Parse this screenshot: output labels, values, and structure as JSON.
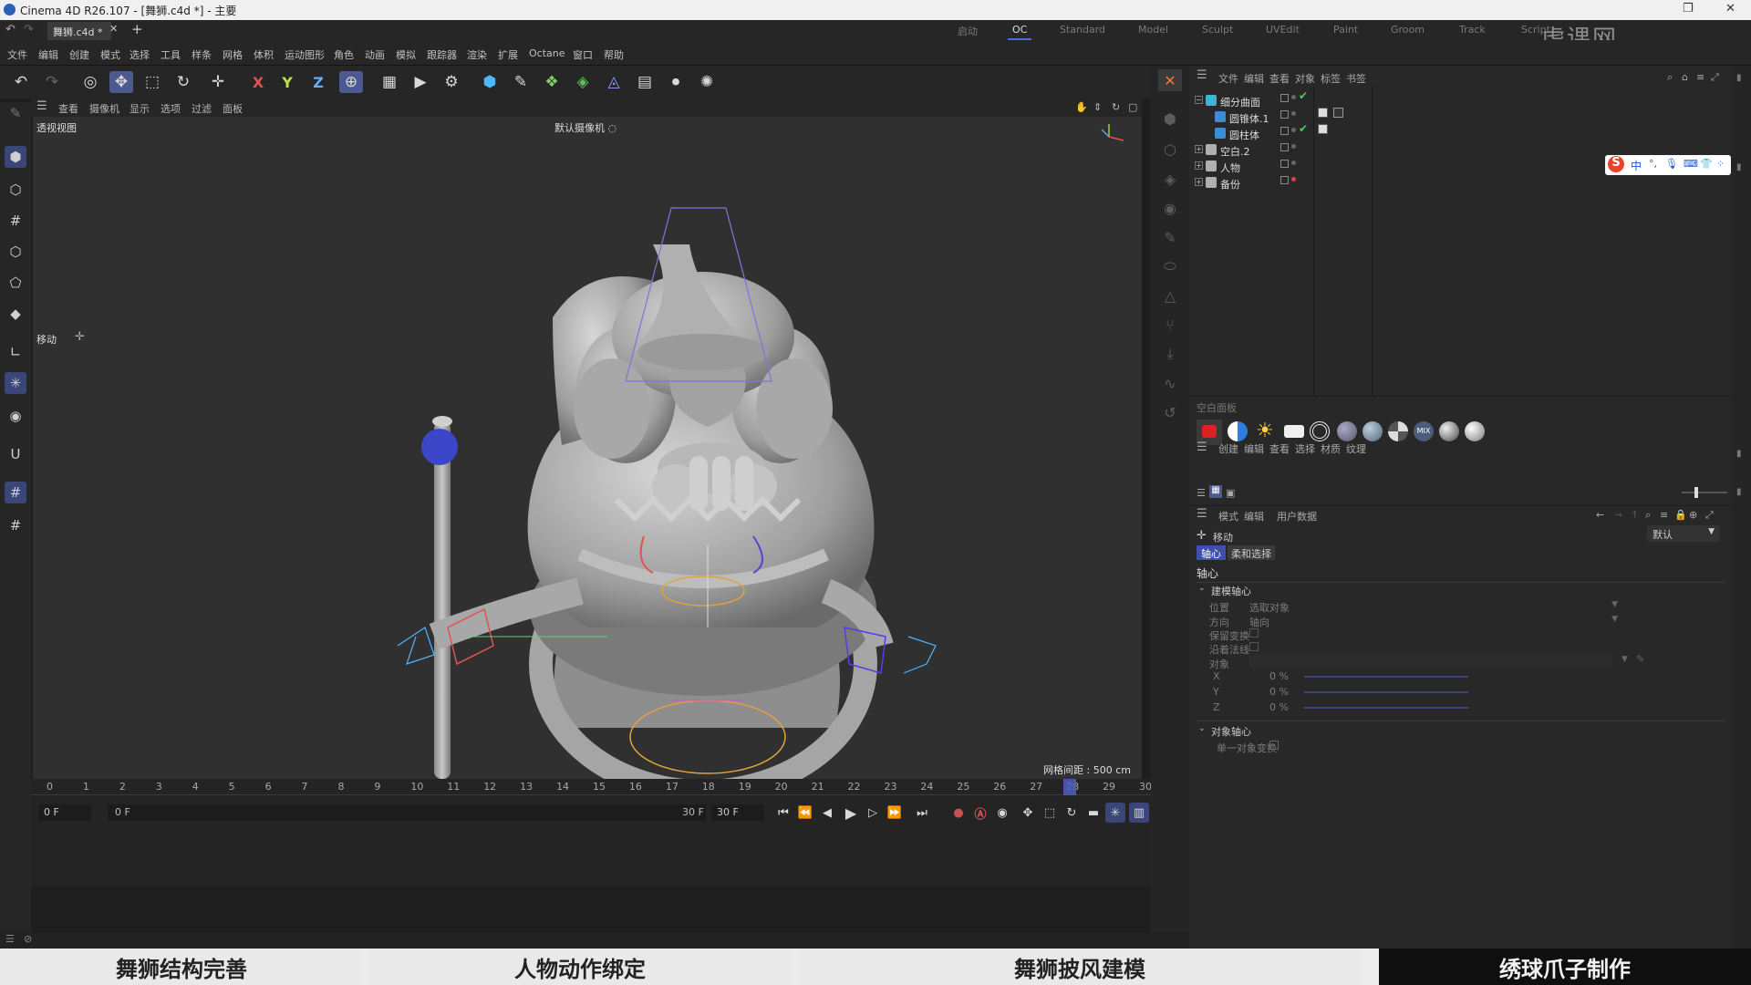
{
  "window": {
    "title": "Cinema 4D R26.107 - [舞狮.c4d *] - 主要",
    "doc_tab": "舞狮.c4d *"
  },
  "layouts": [
    "启动",
    "OC",
    "Standard",
    "Model",
    "Sculpt",
    "UVEdit",
    "Paint",
    "Groom",
    "Track",
    "Script"
  ],
  "menu": [
    "文件",
    "编辑",
    "创建",
    "模式",
    "选择",
    "工具",
    "样条",
    "网格",
    "体积",
    "运动图形",
    "角色",
    "动画",
    "模拟",
    "跟踪器",
    "渲染",
    "扩展",
    "Octane",
    "窗口",
    "帮助"
  ],
  "viewport": {
    "menu": [
      "查看",
      "摄像机",
      "显示",
      "选项",
      "过滤",
      "面板"
    ],
    "name": "透视视图",
    "camera": "默认摄像机 ◌",
    "grid_label": "网格间距 : 500 cm",
    "hud_label": "移动"
  },
  "timeline": {
    "ticks": [
      "0",
      "1",
      "2",
      "3",
      "4",
      "5",
      "6",
      "7",
      "8",
      "9",
      "10",
      "11",
      "12",
      "13",
      "14",
      "15",
      "16",
      "17",
      "18",
      "19",
      "20",
      "21",
      "22",
      "23",
      "24",
      "25",
      "26",
      "27",
      "28",
      "29",
      "30"
    ],
    "current_frame": 28,
    "start_field": "0 F",
    "slider_start": "0 F",
    "slider_end": "30 F",
    "end_field": "30 F"
  },
  "object_manager": {
    "menu": [
      "文件",
      "编辑",
      "查看",
      "对象",
      "标签",
      "书签"
    ],
    "objects": [
      {
        "name": "细分曲面",
        "indent": 0,
        "color": "#3db3d6"
      },
      {
        "name": "圆锥体.1",
        "indent": 1,
        "color": "#3d8cd6"
      },
      {
        "name": "圆柱体",
        "indent": 1,
        "color": "#3d8cd6"
      },
      {
        "name": "空白.2",
        "indent": 0,
        "color": "#b0b0b0"
      },
      {
        "name": "人物",
        "indent": 0,
        "color": "#b0b0b0"
      },
      {
        "name": "备份",
        "indent": 0,
        "color": "#b0b0b0"
      }
    ]
  },
  "material_manager": {
    "title": "空白面板",
    "menu": [
      "创建",
      "编辑",
      "查看",
      "选择",
      "材质",
      "纹理"
    ]
  },
  "attributes": {
    "menu": [
      "模式",
      "编辑",
      "用户数据"
    ],
    "tool": "移动",
    "dropdown": "默认",
    "tabs": [
      "轴心",
      "柔和选择"
    ],
    "section": "轴心",
    "group1": "建模轴心",
    "fields": [
      {
        "label": "位置",
        "value": "选取对象"
      },
      {
        "label": "方向",
        "value": "轴向"
      },
      {
        "label": "保留变换",
        "value": ""
      },
      {
        "label": "沿着法线",
        "value": ""
      },
      {
        "label": "对象",
        "value": ""
      }
    ],
    "xyz": [
      {
        "label": "X",
        "value": "0 %"
      },
      {
        "label": "Y",
        "value": "0 %"
      },
      {
        "label": "Z",
        "value": "0 %"
      }
    ],
    "group2": "对象轴心",
    "cb_label": "单一对象变换"
  },
  "ime": {
    "lang": "中"
  },
  "watermark": "虎课网",
  "bottom_tabs": [
    {
      "label": "舞狮结构完善",
      "active": false
    },
    {
      "label": "人物动作绑定",
      "active": false
    },
    {
      "label": "舞狮披风建模",
      "active": false
    },
    {
      "label": "绣球爪子制作",
      "active": true
    }
  ],
  "colors": {
    "accent": "#4b5a8f",
    "active_tab_bg": "#0f0f0f",
    "selection": "#3b46c8"
  }
}
